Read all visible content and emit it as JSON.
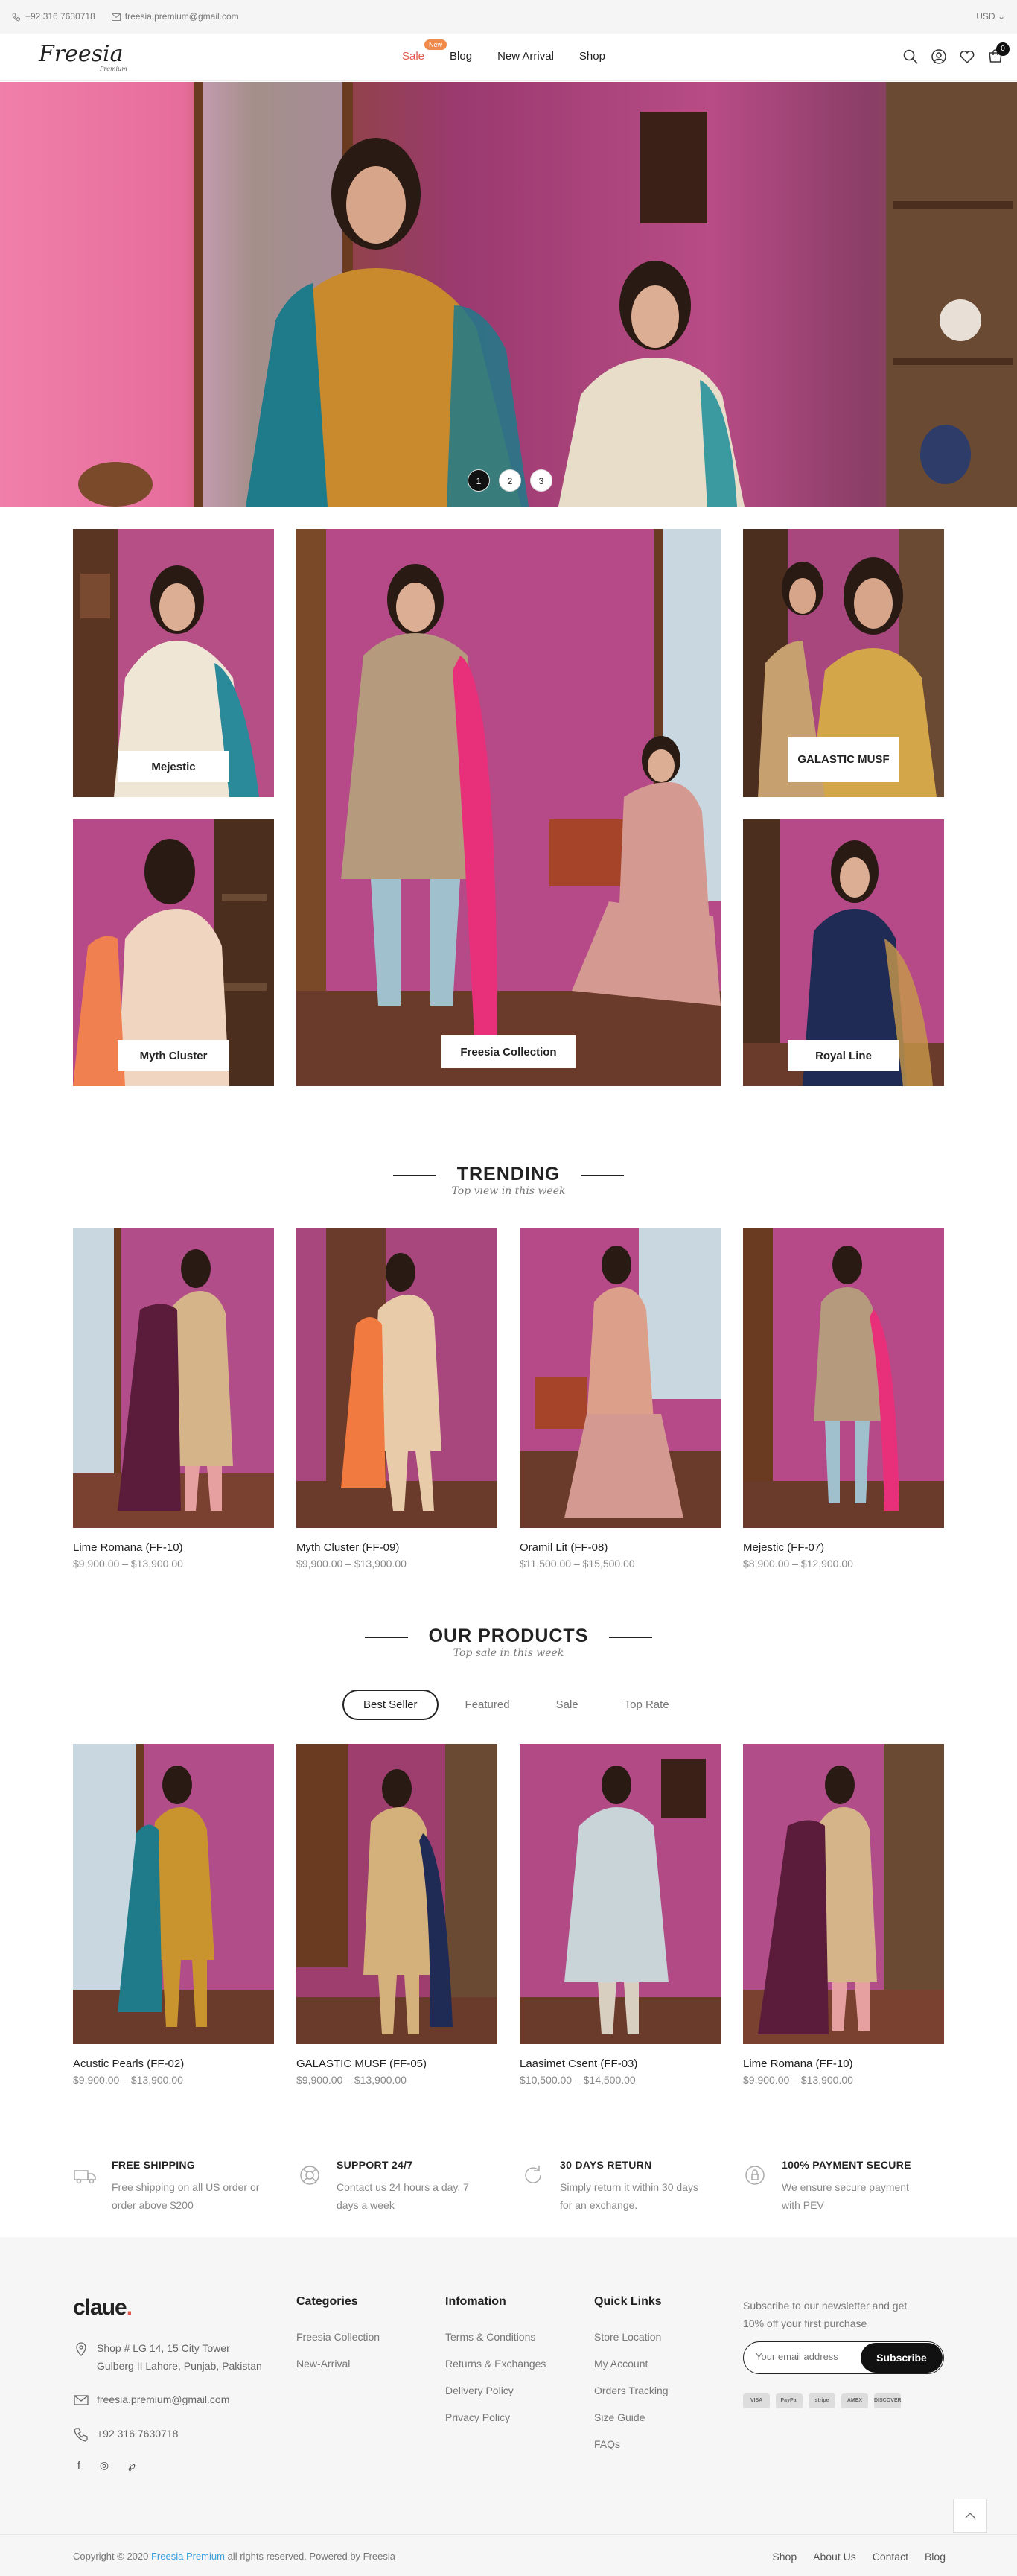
{
  "topbar": {
    "phone": "+92 316 7630718",
    "email": "freesia.premium@gmail.com",
    "currency": "USD"
  },
  "header": {
    "logo_text": "Freesia",
    "logo_sub": "Premium",
    "nav": [
      {
        "label": "Sale",
        "badge": "New"
      },
      {
        "label": "Blog"
      },
      {
        "label": "New Arrival"
      },
      {
        "label": "Shop"
      }
    ],
    "cart_count": "0",
    "icons": [
      "search-icon",
      "user-icon",
      "heart-icon",
      "cart-icon"
    ]
  },
  "hero": {
    "slides": [
      "1",
      "2",
      "3"
    ],
    "active_slide": 1
  },
  "categories": [
    {
      "label": "Mejestic"
    },
    {
      "label": "Freesia Collection"
    },
    {
      "label": "GALASTIC MUSF"
    },
    {
      "label": "Myth Cluster"
    },
    {
      "label": "Royal Line"
    }
  ],
  "trending": {
    "title": "TRENDING",
    "subtitle": "Top view in this week",
    "products": [
      {
        "name": "Lime Romana (FF-10)",
        "price": "$9,900.00 – $13,900.00"
      },
      {
        "name": "Myth Cluster (FF-09)",
        "price": "$9,900.00 – $13,900.00"
      },
      {
        "name": "Oramil Lit (FF-08)",
        "price": "$11,500.00 – $15,500.00"
      },
      {
        "name": "Mejestic (FF-07)",
        "price": "$8,900.00 – $12,900.00"
      }
    ]
  },
  "our_products": {
    "title": "OUR PRODUCTS",
    "subtitle": "Top sale in this week",
    "tabs": [
      "Best Seller",
      "Featured",
      "Sale",
      "Top Rate"
    ],
    "products": [
      {
        "name": "Acustic Pearls (FF-02)",
        "price": "$9,900.00 – $13,900.00"
      },
      {
        "name": "GALASTIC MUSF (FF-05)",
        "price": "$9,900.00 – $13,900.00"
      },
      {
        "name": "Laasimet Csent (FF-03)",
        "price": "$10,500.00 – $14,500.00"
      },
      {
        "name": "Lime Romana (FF-10)",
        "price": "$9,900.00 – $13,900.00"
      }
    ]
  },
  "features": [
    {
      "title": "FREE SHIPPING",
      "line1": "Free shipping on all US order or",
      "line2": "order above $200"
    },
    {
      "title": "SUPPORT 24/7",
      "line1": "Contact us 24 hours a day, 7",
      "line2": "days a week"
    },
    {
      "title": "30 DAYS RETURN",
      "line1": "Simply return it within 30 days",
      "line2": "for an exchange."
    },
    {
      "title": "100% PAYMENT SECURE",
      "line1": "We ensure secure payment",
      "line2": "with PEV"
    }
  ],
  "footer": {
    "brand": "claue",
    "address1": "Shop # LG 14, 15 City Tower",
    "address2": "Gulberg II Lahore, Punjab, Pakistan",
    "email": "freesia.premium@gmail.com",
    "phone": "+92 316 7630718",
    "categories_title": "Categories",
    "categories": [
      "Freesia Collection",
      "New-Arrival"
    ],
    "info_title": "Infomation",
    "info": [
      "Terms & Conditions",
      "Returns & Exchanges",
      "Delivery Policy",
      "Privacy Policy"
    ],
    "quick_title": "Quick Links",
    "quick": [
      "Store Location",
      "My Account",
      "Orders Tracking",
      "Size Guide",
      "FAQs"
    ],
    "newsletter_line1": "Subscribe to our newsletter and get",
    "newsletter_line2": "10% off your first purchase",
    "email_placeholder": "Your email address",
    "subscribe": "Subscribe",
    "payments": [
      "VISA",
      "PayPal",
      "stripe",
      "AMEX",
      "DISCOVER"
    ],
    "copyright_pre": "Copyright © 2020",
    "copyright_link": "Freesia Premium",
    "copyright_post": "all rights reserved. Powered by Freesia",
    "bottom_links": [
      "Shop",
      "About Us",
      "Contact",
      "Blog"
    ]
  },
  "colors": {
    "accent": "#e2584a",
    "magenta": "#c4487a",
    "dark": "#111111"
  }
}
